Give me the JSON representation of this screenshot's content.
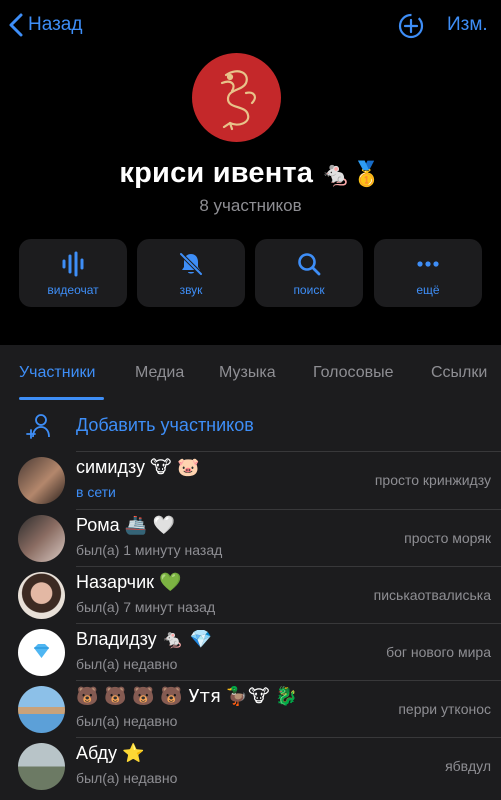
{
  "header": {
    "back_label": "Назад",
    "edit_label": "Изм."
  },
  "group": {
    "name": "криси ивента",
    "name_emoji": "🐁🥇",
    "subtitle": "8 участников",
    "avatar_color": "#c4282a"
  },
  "actions": [
    {
      "label": "видеочат",
      "icon": "voice-wave-icon"
    },
    {
      "label": "звук",
      "icon": "bell-muted-icon"
    },
    {
      "label": "поиск",
      "icon": "search-icon"
    },
    {
      "label": "ещё",
      "icon": "more-dots-icon"
    }
  ],
  "tabs": [
    {
      "label": "Участники",
      "active": true
    },
    {
      "label": "Медиа"
    },
    {
      "label": "Музыка"
    },
    {
      "label": "Голосовые"
    },
    {
      "label": "Ссылки"
    }
  ],
  "add_members_label": "Добавить участников",
  "members": [
    {
      "name": "симидзу",
      "emoji": "🐮 🐷",
      "status": "в сети",
      "online": true,
      "role": "просто кринжидзу"
    },
    {
      "name": "Рома",
      "emoji": "🚢 🤍",
      "status": "был(а) 1 минуту назад",
      "role": "просто моряк"
    },
    {
      "name": "Назарчик",
      "emoji": "💚",
      "status": "был(а) 7 минут назад",
      "role": "писькаотвалиська"
    },
    {
      "name": "Владидзу",
      "emoji": "🐁 💎",
      "status": "был(а) недавно",
      "role": "бог нового мира"
    },
    {
      "name": "🐻 🐻 🐻 🐻 Утя",
      "emoji": "🦆🐮 🐉",
      "status": "был(а) недавно",
      "role": "перри утконос"
    },
    {
      "name": "Абду",
      "emoji": "⭐",
      "status": "был(а) недавно",
      "role": "ябвдул"
    }
  ],
  "colors": {
    "accent": "#3e8ef7",
    "bg": "#000000",
    "panel": "#1c1c1e",
    "muted": "#8e8e93"
  }
}
